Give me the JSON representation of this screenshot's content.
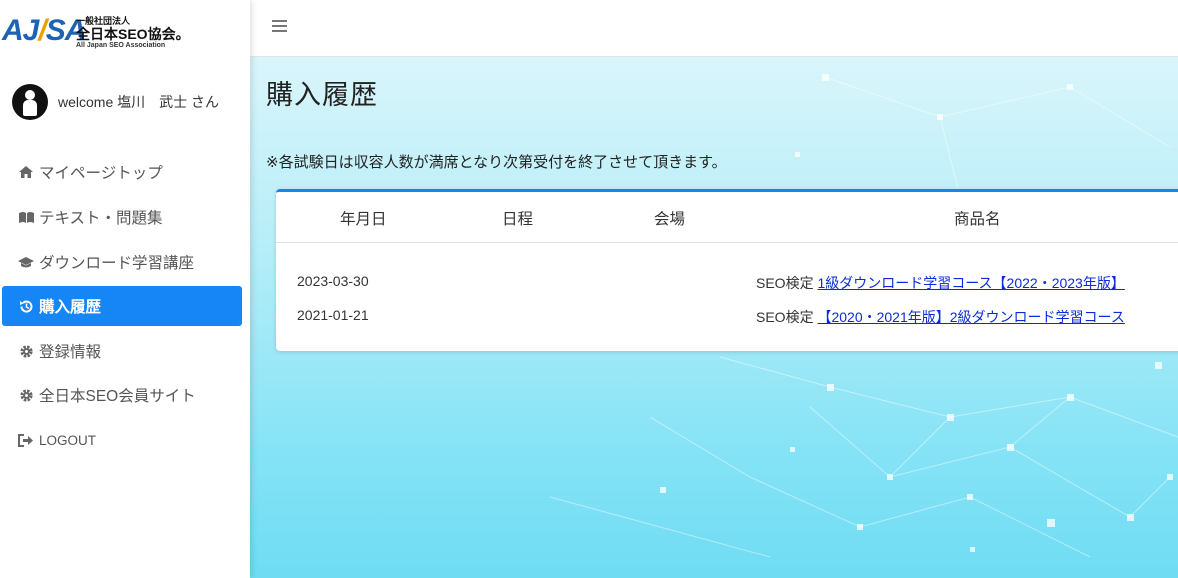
{
  "brand": {
    "logo_text": "AJSA",
    "org_small": "一般社団法人",
    "org_main": "全日本SEO協会。",
    "org_sub": "All Japan SEO Association"
  },
  "user": {
    "welcome": "welcome 塩川　武士 さん"
  },
  "nav": {
    "items": [
      {
        "label": "マイページトップ",
        "icon": "home-icon"
      },
      {
        "label": "テキスト・問題集",
        "icon": "book-icon"
      },
      {
        "label": "ダウンロード学習講座",
        "icon": "graduation-cap-icon"
      },
      {
        "label": "購入履歴",
        "icon": "history-icon",
        "active": true
      },
      {
        "label": "登録情報",
        "icon": "gear-icon"
      },
      {
        "label": "全日本SEO会員サイト",
        "icon": "gear-icon"
      },
      {
        "label": "LOGOUT",
        "icon": "sign-out-icon"
      }
    ]
  },
  "main": {
    "title": "購入履歴",
    "notice": "※各試験日は収容人数が満席となり次第受付を終了させて頂きます。",
    "table": {
      "headers": [
        "年月日",
        "日程",
        "会場",
        "商品名"
      ],
      "rows": [
        {
          "date": "2023-03-30",
          "schedule": "",
          "venue": "",
          "product_prefix": "SEO検定 ",
          "product_link": "1級ダウンロード学習コース【2022・2023年版】"
        },
        {
          "date": "2021-01-21",
          "schedule": "",
          "venue": "",
          "product_prefix": "SEO検定 ",
          "product_link": "【2020・2021年版】2級ダウンロード学習コース"
        }
      ]
    }
  },
  "colors": {
    "accent": "#1685f5",
    "link": "#0b2bd9",
    "brand_blue": "#1d63b5",
    "brand_gold": "#e8a100"
  }
}
